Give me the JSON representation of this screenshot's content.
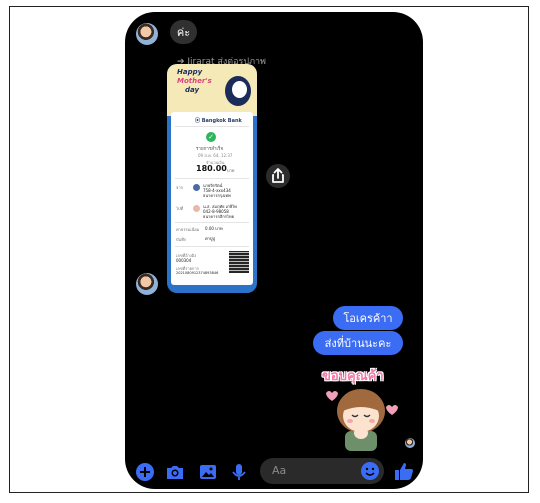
{
  "chat": {
    "top_reply": "ค่ะ",
    "forwarded_label": "Jirarat ส่งต่อรูปภาพ",
    "outgoing_messages": [
      "โอเครค้าา",
      "ส่งที่บ้านนะคะ"
    ],
    "sticker_text": "ขอบคุณค้า"
  },
  "slip": {
    "banner_text": [
      "Happy",
      "Mother's",
      "day"
    ],
    "bank_name": "Bangkok Bank",
    "status": "รายการสำเร็จ",
    "date": "09 ส.ค. 64, 12:37",
    "amount_label": "จำนวนเงิน",
    "amount": "180.00",
    "amount_unit": "บาท",
    "from_label": "จาก",
    "from_name": "นายจิรรัตน์",
    "from_acc": "758-4-xxx434",
    "from_bank": "ธนาคารกรุงเทพ",
    "to_label": "ไปที่",
    "to_name": "น.ส. สมฤทัย เกษีไพ",
    "to_acc": "042-8-98058",
    "to_bank": "ธนาคารกสิกรไทย",
    "fee_label": "ค่าธรรมเนียม",
    "fee": "0.00 บาท",
    "note_label": "บันทึก",
    "note": "ค่าปูบู่",
    "ref_label": "เลขที่อ้างอิง",
    "ref": "000304",
    "ref2_label": "เลขที่รายการ",
    "ref2": "2021080912374893846"
  },
  "composer": {
    "placeholder": "Aa"
  },
  "colors": {
    "accent": "#3b6cf4",
    "background": "#000000"
  },
  "icons": [
    "plus-icon",
    "camera-icon",
    "image-icon",
    "microphone-icon",
    "emoji-icon",
    "thumbs-up-icon",
    "share-icon"
  ]
}
